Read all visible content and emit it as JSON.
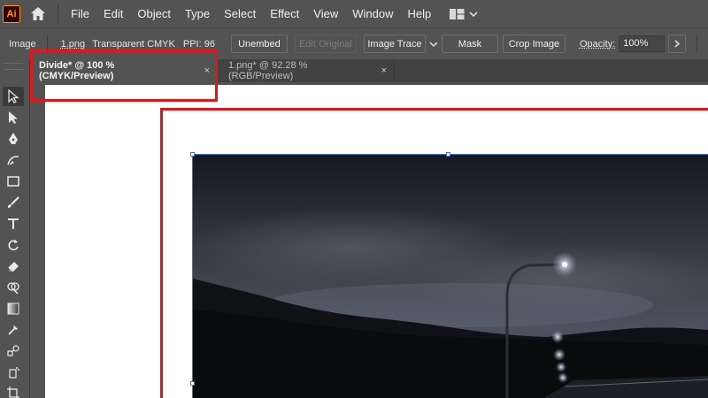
{
  "app": {
    "logo_text": "Ai"
  },
  "menu": [
    "File",
    "Edit",
    "Object",
    "Type",
    "Select",
    "Effect",
    "View",
    "Window",
    "Help"
  ],
  "control": {
    "object_type": "Image",
    "file_name": "1.png",
    "color_mode": "Transparent CMYK",
    "ppi": "PPI: 96",
    "unembed": "Unembed",
    "edit_original": "Edit Original",
    "image_trace": "Image Trace",
    "mask": "Mask",
    "crop_image": "Crop Image",
    "opacity_label": "Opacity:",
    "opacity_value": "100%"
  },
  "tabs": [
    {
      "label": "Divide* @ 100 % (CMYK/Preview)",
      "active": true,
      "close": "×"
    },
    {
      "label": "1.png* @ 92.28 % (RGB/Preview)",
      "active": false,
      "close": "×"
    }
  ],
  "tools": [
    "direct-selection",
    "selection",
    "pen",
    "curvature",
    "rectangle",
    "paintbrush",
    "type",
    "rotate",
    "eraser",
    "shape-builder",
    "gradient",
    "eyedropper",
    "blend",
    "symbol-sprayer",
    "artboard"
  ],
  "colors": {
    "highlight": "#e0161c",
    "selection": "#4a6cd0",
    "logo_orange": "#ff9a00"
  }
}
